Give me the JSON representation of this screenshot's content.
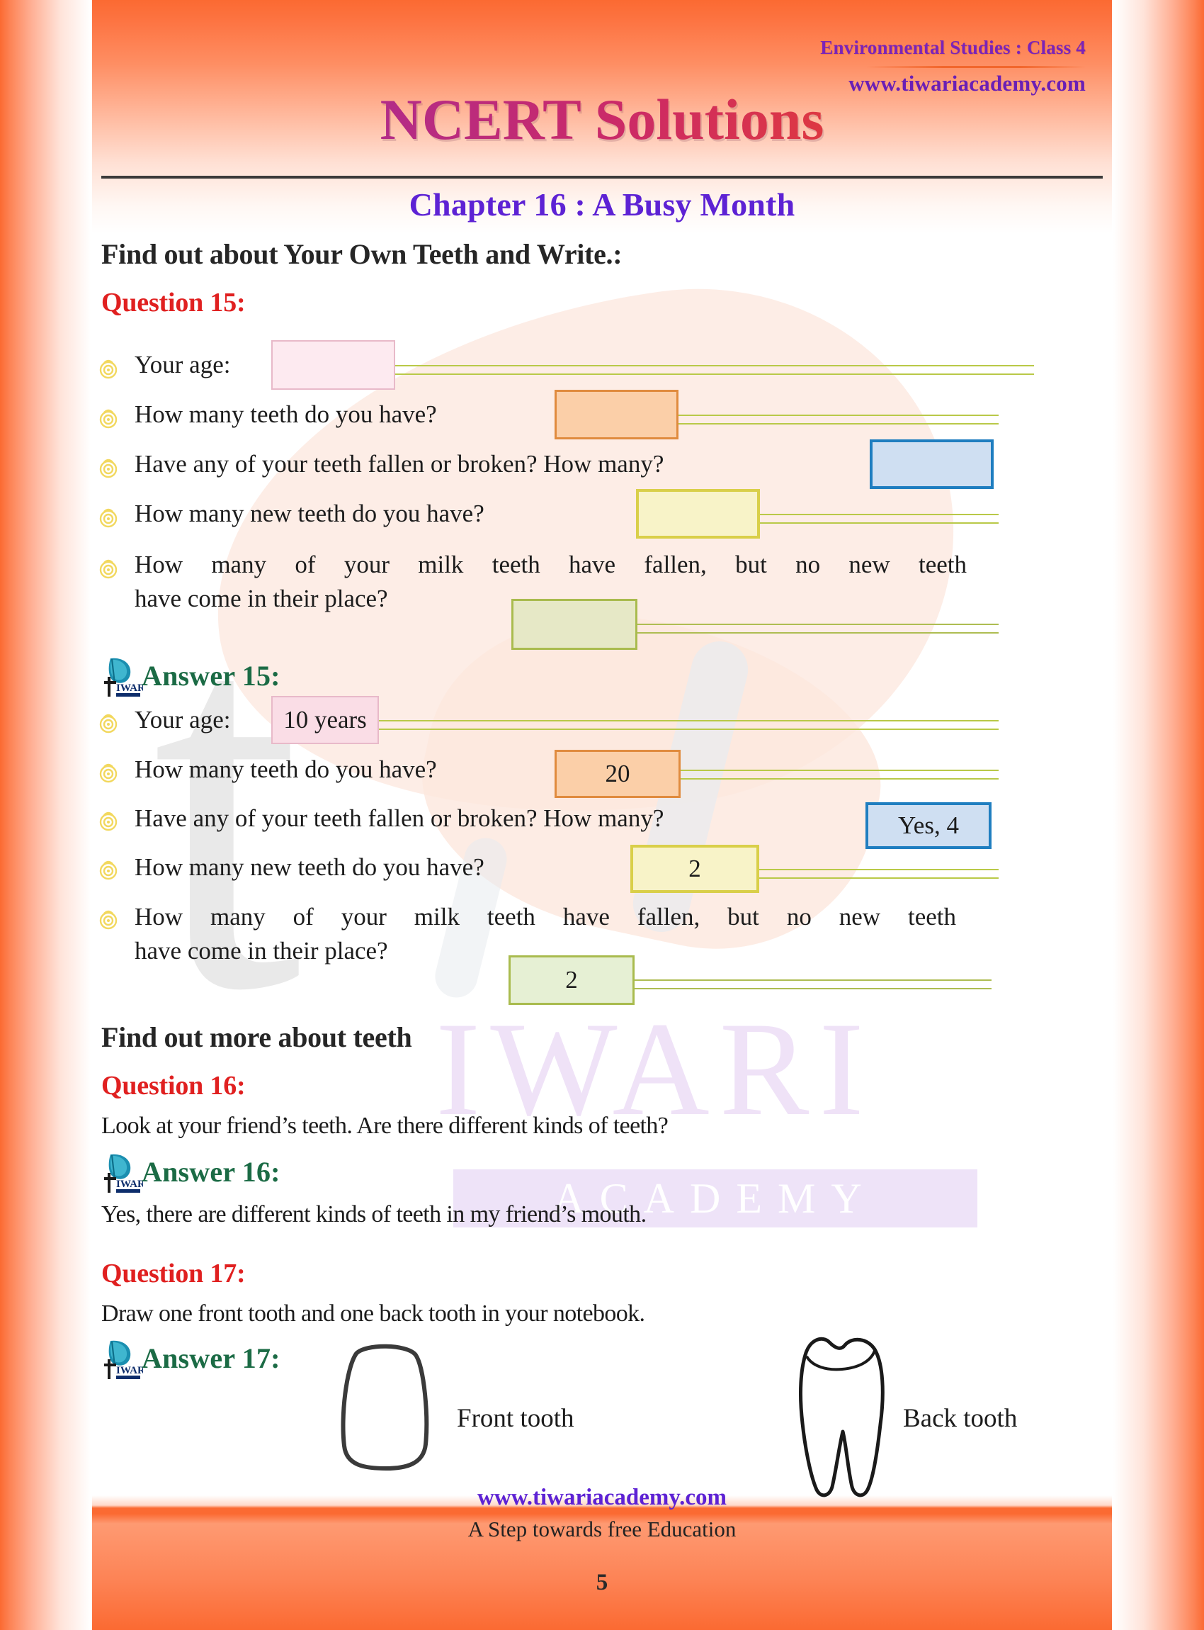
{
  "header": {
    "subject_line": "Environmental Studies : Class 4",
    "website": "www.tiwariacademy.com",
    "brand_title": "NCERT Solutions",
    "chapter": "Chapter 16 : A Busy Month"
  },
  "sections": {
    "section1_heading": "Find out about Your Own Teeth and Write.:",
    "question15_label": "Question 15:",
    "answer15_label": "Answer  15:",
    "section2_heading": "Find out more about teeth",
    "question16_label": "Question 16:",
    "question16_text": "Look at your friend’s teeth. Are there different kinds of teeth?",
    "answer16_label": "Answer  16:",
    "answer16_text": "Yes, there are different kinds of teeth in my friend’s mouth.",
    "question17_label": "Question 17:",
    "question17_text": "Draw one front tooth and one back tooth in your notebook.",
    "answer17_label": "Answer  17:"
  },
  "question15_items": [
    {
      "text": "Your age:",
      "answer": "",
      "box_color": "pink"
    },
    {
      "text": "How many teeth do you have?",
      "answer": "",
      "box_color": "orange"
    },
    {
      "text": "Have any of your teeth fallen or broken? How many?",
      "answer": "",
      "box_color": "blue"
    },
    {
      "text": "How many new teeth do you have?",
      "answer": "",
      "box_color": "yellow"
    },
    {
      "text_line1": "How many of your milk teeth have fallen, but no new teeth",
      "text_line2": "have come in their place?",
      "answer": "",
      "box_color": "olive"
    }
  ],
  "answer15_items": [
    {
      "text": "Your age:",
      "answer": "10 years",
      "box_color": "pink"
    },
    {
      "text": "How many teeth do you have?",
      "answer": "20",
      "box_color": "orange"
    },
    {
      "text": "Have any of your teeth fallen or broken? How many?",
      "answer": "Yes, 4",
      "box_color": "blue"
    },
    {
      "text": "How many new teeth do you have?",
      "answer": "2",
      "box_color": "yellow"
    },
    {
      "text_line1": "How many of your milk teeth have fallen, but no new teeth",
      "text_line2": "have come in their place?",
      "answer": "2",
      "box_color": "olive"
    }
  ],
  "teeth": {
    "front_label": "Front tooth",
    "back_label": "Back tooth"
  },
  "watermark": {
    "letter": "t",
    "word1": "IWARI",
    "word2": "ACADEMY"
  },
  "logo": {
    "mark_letter": "t",
    "mark_word": "IWARI",
    "mark_sub": "ACADEMY"
  },
  "footer": {
    "website": "www.tiwariacademy.com",
    "tagline": "A Step towards free Education",
    "page_number": "5"
  },
  "colors": {
    "brand_orange": "#fb6a32",
    "question_red": "#e02020",
    "answer_green": "#1b6b45",
    "chapter_purple": "#5d22d4",
    "header_purple": "#6a1fb5",
    "box_pink_fill": "#fdeaf0",
    "box_pink_border": "#e8b9c9",
    "box_orange_fill": "#fbcfa8",
    "box_orange_border": "#e08b3e",
    "box_blue_fill": "#cfdff2",
    "box_blue_border": "#1f7ec0",
    "box_yellow_fill": "#f8f3c8",
    "box_yellow_border": "#d9cf49",
    "box_olive_fill": "#e6e8c6",
    "box_olive_border": "#a9bb4e",
    "rail_green": "#b9c948"
  }
}
